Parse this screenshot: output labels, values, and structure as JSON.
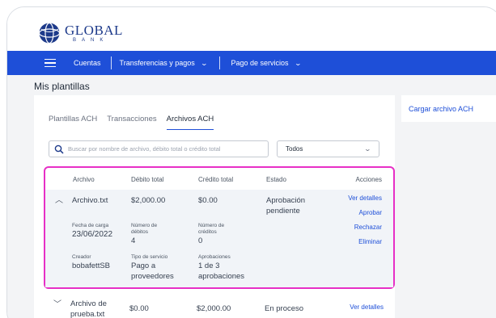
{
  "brand": {
    "name": "GLOBAL",
    "sub": "BANK",
    "primary": "#1e4fd8",
    "highlight": "#e72fc6"
  },
  "nav": {
    "items": [
      "Cuentas",
      "Transferencias y pagos",
      "Pago de servicios"
    ]
  },
  "page": {
    "title": "Mis plantillas"
  },
  "tabs": [
    "Plantillas ACH",
    "Transacciones",
    "Archivos ACH"
  ],
  "active_tab": "Archivos ACH",
  "search": {
    "placeholder": "Buscar por nombre de archivo, débito total o crédito total"
  },
  "filter": {
    "selected": "Todos"
  },
  "upload_button": "Cargar archivo ACH",
  "table": {
    "headers": [
      "Archivo",
      "Débito total",
      "Crédito total",
      "Estado",
      "Acciones"
    ],
    "rows": [
      {
        "file": "Archivo.txt",
        "debit": "$2,000.00",
        "credit": "$0.00",
        "status": [
          "Aprobación",
          "pendiente"
        ],
        "actions": [
          "Ver detalles",
          "Aprobar",
          "Rechazar",
          "Eliminar"
        ],
        "details": {
          "load_date_label": "Fecha de carga",
          "load_date": "23/06/2022",
          "debits_label": [
            "Número de",
            "débitos"
          ],
          "debits": "4",
          "credits_label": [
            "Número de",
            "créditos"
          ],
          "credits": "0",
          "creator_label": "Creador",
          "creator": "bobafettSB",
          "service_label": "Tipo de servicio",
          "service": [
            "Pago a",
            "proveedores"
          ],
          "approvals_label": "Aprobaciones",
          "approvals": [
            "1 de 3",
            "aprobaciones"
          ]
        }
      },
      {
        "file": [
          "Archivo de",
          "prueba.txt"
        ],
        "debit": "$0.00",
        "credit": "$2,000.00",
        "status": "En proceso",
        "actions": [
          "Ver detalles"
        ]
      }
    ]
  }
}
